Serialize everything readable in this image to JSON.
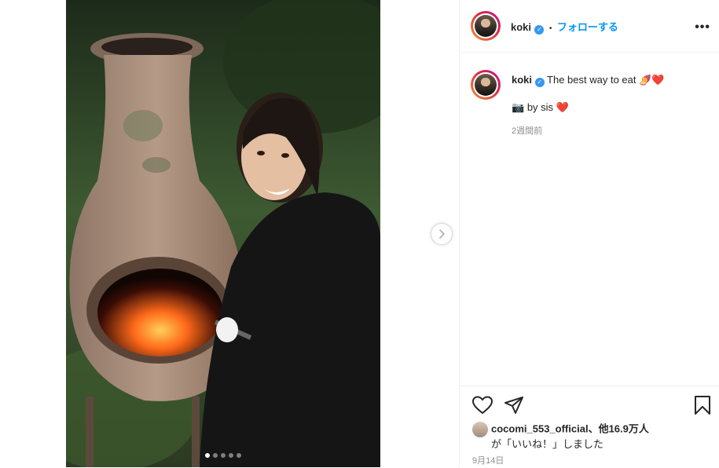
{
  "post": {
    "image_alt": "",
    "carousel": {
      "count": 5,
      "active_index": 0
    }
  },
  "header": {
    "username": "koki",
    "separator": "•",
    "follow_label": "フォローする",
    "more_label": "•••"
  },
  "caption": {
    "username": "koki",
    "text": "The best way to eat",
    "emoji_1": "🍠",
    "emoji_2": "❤️",
    "line2_camera": "📷",
    "line2_text": "by sis",
    "line2_emoji": "❤️",
    "time_ago": "2週間前"
  },
  "likes": {
    "liker": "cocomi_553_official",
    "suffix": "、他16.9万人",
    "line2": "が「いいね！」しました"
  },
  "date": "9月14日",
  "icons": {
    "heart": "heart-icon",
    "share": "send-icon",
    "bookmark": "bookmark-icon",
    "next": "chevron-right-icon",
    "verified": "verified-badge-icon"
  },
  "colors": {
    "accent": "#0095f6",
    "verified": "#3897f0",
    "heart_red": "#e0162b"
  }
}
